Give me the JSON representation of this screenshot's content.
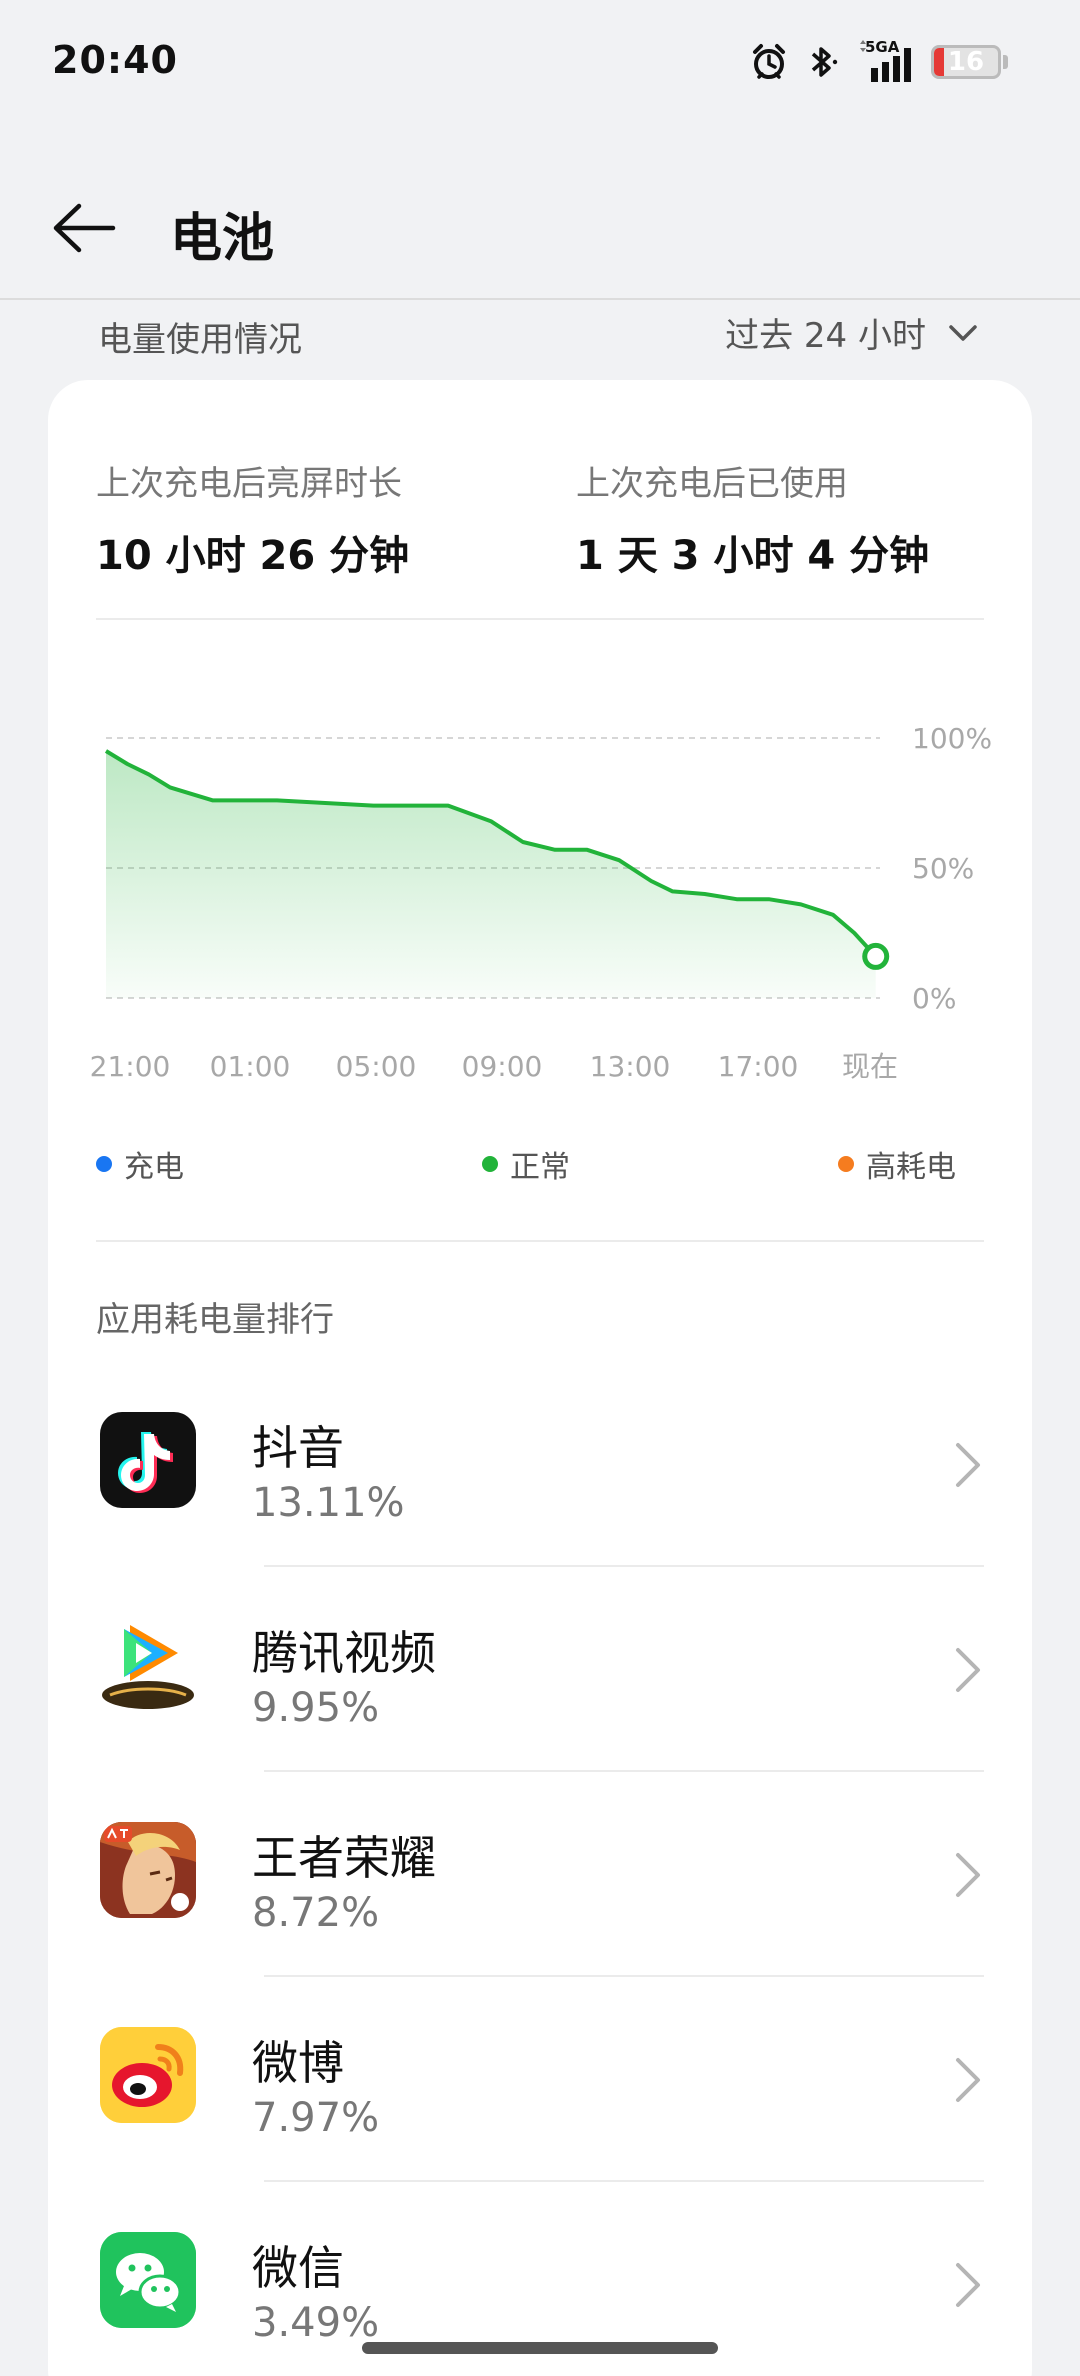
{
  "status_bar": {
    "time": "20:40",
    "network": "5GA",
    "battery_level": "16",
    "battery_fraction": 0.16,
    "icons": [
      "alarm-icon",
      "bluetooth-icon",
      "cellular-signal-icon",
      "battery-icon"
    ]
  },
  "header": {
    "title": "电池",
    "back_icon": "back-arrow-icon"
  },
  "usage": {
    "label": "电量使用情况",
    "period": "过去 24 小时",
    "screen_on_label": "上次充电后亮屏时长",
    "screen_on_value": "10 小时 26 分钟",
    "used_label": "上次充电后已使用",
    "used_value": "1 天 3 小时 4 分钟"
  },
  "chart_data": {
    "type": "area",
    "x_ticks": [
      "21:00",
      "01:00",
      "05:00",
      "09:00",
      "13:00",
      "17:00",
      "现在"
    ],
    "y_ticks": [
      "100%",
      "50%",
      "0%"
    ],
    "ylim": [
      0,
      100
    ],
    "series": [
      {
        "name": "正常",
        "color": "#22b33a",
        "x": [
          20.5,
          21.5,
          22.5,
          23.5,
          25.5,
          28.5,
          33.0,
          36.5,
          38.5,
          40.0,
          41.5,
          43.0,
          44.5,
          46.0,
          47.0,
          48.5,
          50.0,
          51.5,
          53.0,
          54.5,
          55.5,
          56.5
        ],
        "y": [
          95,
          90,
          86,
          81,
          76,
          76,
          74,
          74,
          68,
          60,
          57,
          57,
          53,
          45,
          41,
          40,
          38,
          38,
          36,
          32,
          25,
          16
        ]
      }
    ],
    "x_domain_hours": [
      20.5,
      56.7
    ],
    "grid": true
  },
  "legend": {
    "charging": {
      "label": "充电",
      "color": "#1976f2"
    },
    "normal": {
      "label": "正常",
      "color": "#22b33a"
    },
    "high": {
      "label": "高耗电",
      "color": "#f57c1f"
    }
  },
  "ranking": {
    "title": "应用耗电量排行",
    "apps": [
      {
        "name": "抖音",
        "percent": "13.11%",
        "icon": "douyin-icon"
      },
      {
        "name": "腾讯视频",
        "percent": "9.95%",
        "icon": "tencent-video-icon"
      },
      {
        "name": "王者荣耀",
        "percent": "8.72%",
        "icon": "honor-of-kings-icon"
      },
      {
        "name": "微博",
        "percent": "7.97%",
        "icon": "weibo-icon"
      },
      {
        "name": "微信",
        "percent": "3.49%",
        "icon": "wechat-icon"
      }
    ]
  }
}
